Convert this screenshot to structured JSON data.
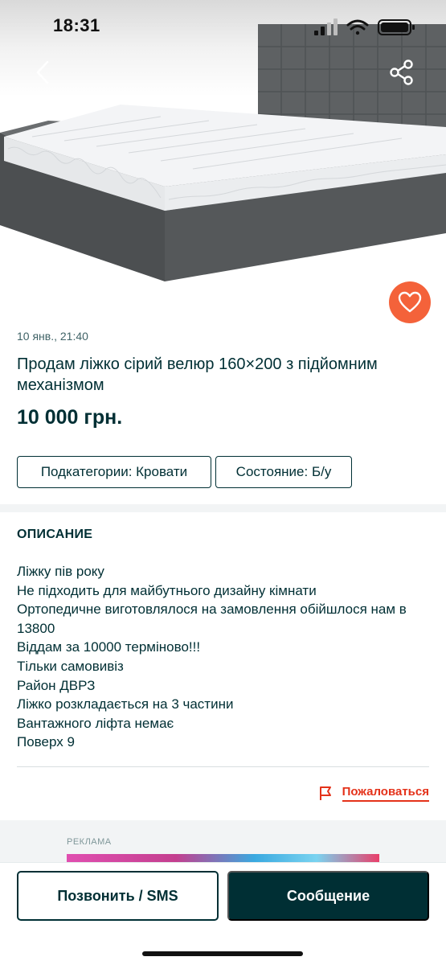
{
  "status_bar": {
    "time": "18:31",
    "icons": [
      "signal-icon",
      "wifi-icon",
      "battery-icon"
    ]
  },
  "hero": {
    "icons": {
      "back": "chevron-left-icon",
      "share": "share-icon",
      "favorite": "heart-icon"
    }
  },
  "listing": {
    "date": "10 янв., 21:40",
    "title": "Продам ліжко сірий велюр 160×200  з підйомним механізмом",
    "price": "10 000 грн.",
    "chips": [
      "Подкатегории: Кровати",
      "Состояние: Б/у"
    ]
  },
  "description": {
    "heading": "ОПИСАНИЕ",
    "lines": [
      "Ліжку пів року",
      "Не підходить для майбутнього дизайну кімнати",
      "Ортопедичне виготовлялося на замовлення обійшлося нам в 13800",
      "Віддам за 10000 терміново!!!",
      "Тільки самовивіз",
      "Район ДВРЗ",
      "Ліжко розкладається на 3 частини",
      "Вантажного ліфта немає",
      "Поверх 9"
    ]
  },
  "report": {
    "label": "Пожаловаться",
    "icon": "flag-icon"
  },
  "ad": {
    "label": "РЕКЛАМА"
  },
  "actions": {
    "call_label": "Позвонить / SMS",
    "message_label": "Сообщение"
  },
  "colors": {
    "primary": "#002f34",
    "accent": "#f4623a",
    "danger": "#e4321a",
    "band": "#f2f4f5"
  }
}
